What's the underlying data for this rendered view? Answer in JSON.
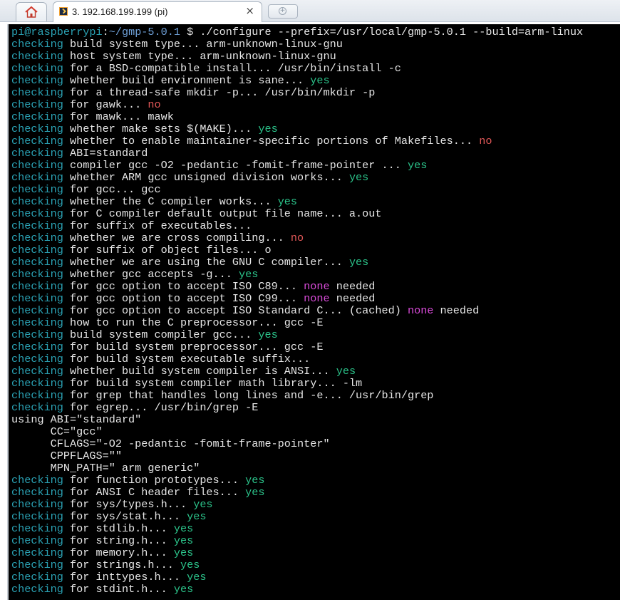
{
  "tabs": {
    "home_icon": "home-icon",
    "session_title": "3. 192.168.199.199 (pi)",
    "close_glyph": "×",
    "new_tab_icon": "new-tab-icon"
  },
  "colors": {
    "checking": "#2aa1b3",
    "yes": "#2bc38a",
    "no": "#e05757",
    "none": "#d84bd8",
    "background": "#000000",
    "text": "#e6e6e6"
  },
  "terminal": {
    "prompt_user": "pi@raspberrypi",
    "prompt_sep": ":",
    "prompt_path": "~/gmp-5.0.1",
    "prompt_sym": " $ ",
    "command": "./configure --prefix=/usr/local/gmp-5.0.1 --build=arm-linux",
    "lines": [
      [
        [
          "chk",
          "checking"
        ],
        [
          "t",
          " build system type... arm-unknown-linux-gnu"
        ]
      ],
      [
        [
          "chk",
          "checking"
        ],
        [
          "t",
          " host system type... arm-unknown-linux-gnu"
        ]
      ],
      [
        [
          "chk",
          "checking"
        ],
        [
          "t",
          " for a BSD-compatible install... /usr/bin/install -c"
        ]
      ],
      [
        [
          "chk",
          "checking"
        ],
        [
          "t",
          " whether build environment is sane... "
        ],
        [
          "yes",
          "yes"
        ]
      ],
      [
        [
          "chk",
          "checking"
        ],
        [
          "t",
          " for a thread-safe mkdir -p... /usr/bin/mkdir -p"
        ]
      ],
      [
        [
          "chk",
          "checking"
        ],
        [
          "t",
          " for gawk... "
        ],
        [
          "no",
          "no"
        ]
      ],
      [
        [
          "chk",
          "checking"
        ],
        [
          "t",
          " for mawk... mawk"
        ]
      ],
      [
        [
          "chk",
          "checking"
        ],
        [
          "t",
          " whether make sets $(MAKE)... "
        ],
        [
          "yes",
          "yes"
        ]
      ],
      [
        [
          "chk",
          "checking"
        ],
        [
          "t",
          " whether to enable maintainer-specific portions of Makefiles... "
        ],
        [
          "no",
          "no"
        ]
      ],
      [
        [
          "chk",
          "checking"
        ],
        [
          "t",
          " ABI=standard"
        ]
      ],
      [
        [
          "chk",
          "checking"
        ],
        [
          "t",
          " compiler gcc -O2 -pedantic -fomit-frame-pointer ... "
        ],
        [
          "yes",
          "yes"
        ]
      ],
      [
        [
          "chk",
          "checking"
        ],
        [
          "t",
          " whether ARM gcc unsigned division works... "
        ],
        [
          "yes",
          "yes"
        ]
      ],
      [
        [
          "chk",
          "checking"
        ],
        [
          "t",
          " for gcc... gcc"
        ]
      ],
      [
        [
          "chk",
          "checking"
        ],
        [
          "t",
          " whether the C compiler works... "
        ],
        [
          "yes",
          "yes"
        ]
      ],
      [
        [
          "chk",
          "checking"
        ],
        [
          "t",
          " for C compiler default output file name... a.out"
        ]
      ],
      [
        [
          "chk",
          "checking"
        ],
        [
          "t",
          " for suffix of executables..."
        ]
      ],
      [
        [
          "chk",
          "checking"
        ],
        [
          "t",
          " whether we are cross compiling... "
        ],
        [
          "no",
          "no"
        ]
      ],
      [
        [
          "chk",
          "checking"
        ],
        [
          "t",
          " for suffix of object files... o"
        ]
      ],
      [
        [
          "chk",
          "checking"
        ],
        [
          "t",
          " whether we are using the GNU C compiler... "
        ],
        [
          "yes",
          "yes"
        ]
      ],
      [
        [
          "chk",
          "checking"
        ],
        [
          "t",
          " whether gcc accepts -g... "
        ],
        [
          "yes",
          "yes"
        ]
      ],
      [
        [
          "chk",
          "checking"
        ],
        [
          "t",
          " for gcc option to accept ISO C89... "
        ],
        [
          "none",
          "none"
        ],
        [
          "t",
          " needed"
        ]
      ],
      [
        [
          "chk",
          "checking"
        ],
        [
          "t",
          " for gcc option to accept ISO C99... "
        ],
        [
          "none",
          "none"
        ],
        [
          "t",
          " needed"
        ]
      ],
      [
        [
          "chk",
          "checking"
        ],
        [
          "t",
          " for gcc option to accept ISO Standard C... (cached) "
        ],
        [
          "none",
          "none"
        ],
        [
          "t",
          " needed"
        ]
      ],
      [
        [
          "chk",
          "checking"
        ],
        [
          "t",
          " how to run the C preprocessor... gcc -E"
        ]
      ],
      [
        [
          "chk",
          "checking"
        ],
        [
          "t",
          " build system compiler gcc... "
        ],
        [
          "yes",
          "yes"
        ]
      ],
      [
        [
          "chk",
          "checking"
        ],
        [
          "t",
          " for build system preprocessor... gcc -E"
        ]
      ],
      [
        [
          "chk",
          "checking"
        ],
        [
          "t",
          " for build system executable suffix..."
        ]
      ],
      [
        [
          "chk",
          "checking"
        ],
        [
          "t",
          " whether build system compiler is ANSI... "
        ],
        [
          "yes",
          "yes"
        ]
      ],
      [
        [
          "chk",
          "checking"
        ],
        [
          "t",
          " for build system compiler math library... -lm"
        ]
      ],
      [
        [
          "chk",
          "checking"
        ],
        [
          "t",
          " for grep that handles long lines and -e... /usr/bin/grep"
        ]
      ],
      [
        [
          "chk",
          "checking"
        ],
        [
          "t",
          " for egrep... /usr/bin/grep -E"
        ]
      ],
      [
        [
          "t",
          "using ABI=\"standard\""
        ]
      ],
      [
        [
          "t",
          "      CC=\"gcc\""
        ]
      ],
      [
        [
          "t",
          "      CFLAGS=\"-O2 -pedantic -fomit-frame-pointer\""
        ]
      ],
      [
        [
          "t",
          "      CPPFLAGS=\"\""
        ]
      ],
      [
        [
          "t",
          "      MPN_PATH=\" arm generic\""
        ]
      ],
      [
        [
          "chk",
          "checking"
        ],
        [
          "t",
          " for function prototypes... "
        ],
        [
          "yes",
          "yes"
        ]
      ],
      [
        [
          "chk",
          "checking"
        ],
        [
          "t",
          " for ANSI C header files... "
        ],
        [
          "yes",
          "yes"
        ]
      ],
      [
        [
          "chk",
          "checking"
        ],
        [
          "t",
          " for sys/types.h... "
        ],
        [
          "yes",
          "yes"
        ]
      ],
      [
        [
          "chk",
          "checking"
        ],
        [
          "t",
          " for sys/stat.h... "
        ],
        [
          "yes",
          "yes"
        ]
      ],
      [
        [
          "chk",
          "checking"
        ],
        [
          "t",
          " for stdlib.h... "
        ],
        [
          "yes",
          "yes"
        ]
      ],
      [
        [
          "chk",
          "checking"
        ],
        [
          "t",
          " for string.h... "
        ],
        [
          "yes",
          "yes"
        ]
      ],
      [
        [
          "chk",
          "checking"
        ],
        [
          "t",
          " for memory.h... "
        ],
        [
          "yes",
          "yes"
        ]
      ],
      [
        [
          "chk",
          "checking"
        ],
        [
          "t",
          " for strings.h... "
        ],
        [
          "yes",
          "yes"
        ]
      ],
      [
        [
          "chk",
          "checking"
        ],
        [
          "t",
          " for inttypes.h... "
        ],
        [
          "yes",
          "yes"
        ]
      ],
      [
        [
          "chk",
          "checking"
        ],
        [
          "t",
          " for stdint.h... "
        ],
        [
          "yes",
          "yes"
        ]
      ]
    ]
  }
}
